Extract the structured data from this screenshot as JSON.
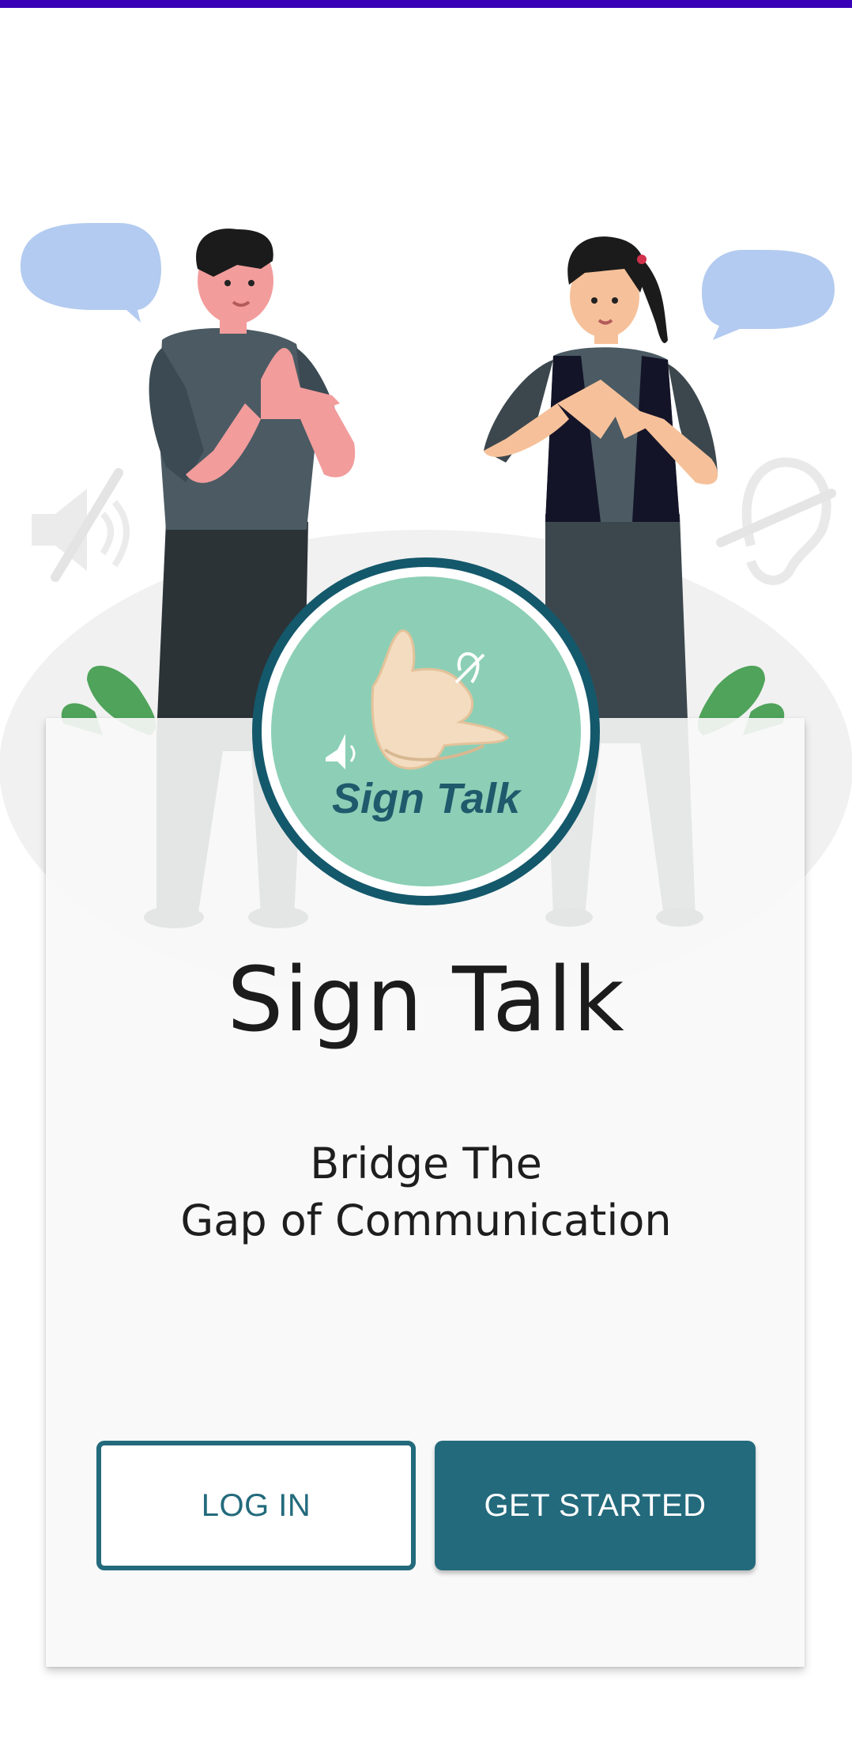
{
  "app": {
    "title": "Sign Talk",
    "tagline_line1": "Bridge The",
    "tagline_line2": "Gap of Communication"
  },
  "logo": {
    "text": "Sign Talk",
    "icon": "hand-sign-icon"
  },
  "actions": {
    "login_label": "LOG IN",
    "get_started_label": "GET STARTED"
  },
  "illustration": {
    "icons": [
      "speech-bubble-icon",
      "muted-speaker-icon",
      "deaf-ear-icon",
      "leaf-icon"
    ]
  },
  "colors": {
    "status_bar": "#3a00b8",
    "primary": "#236a7c",
    "logo_ring": "#14586b",
    "logo_fill": "#8ccfb6",
    "bubble": "#b3cbf0"
  }
}
